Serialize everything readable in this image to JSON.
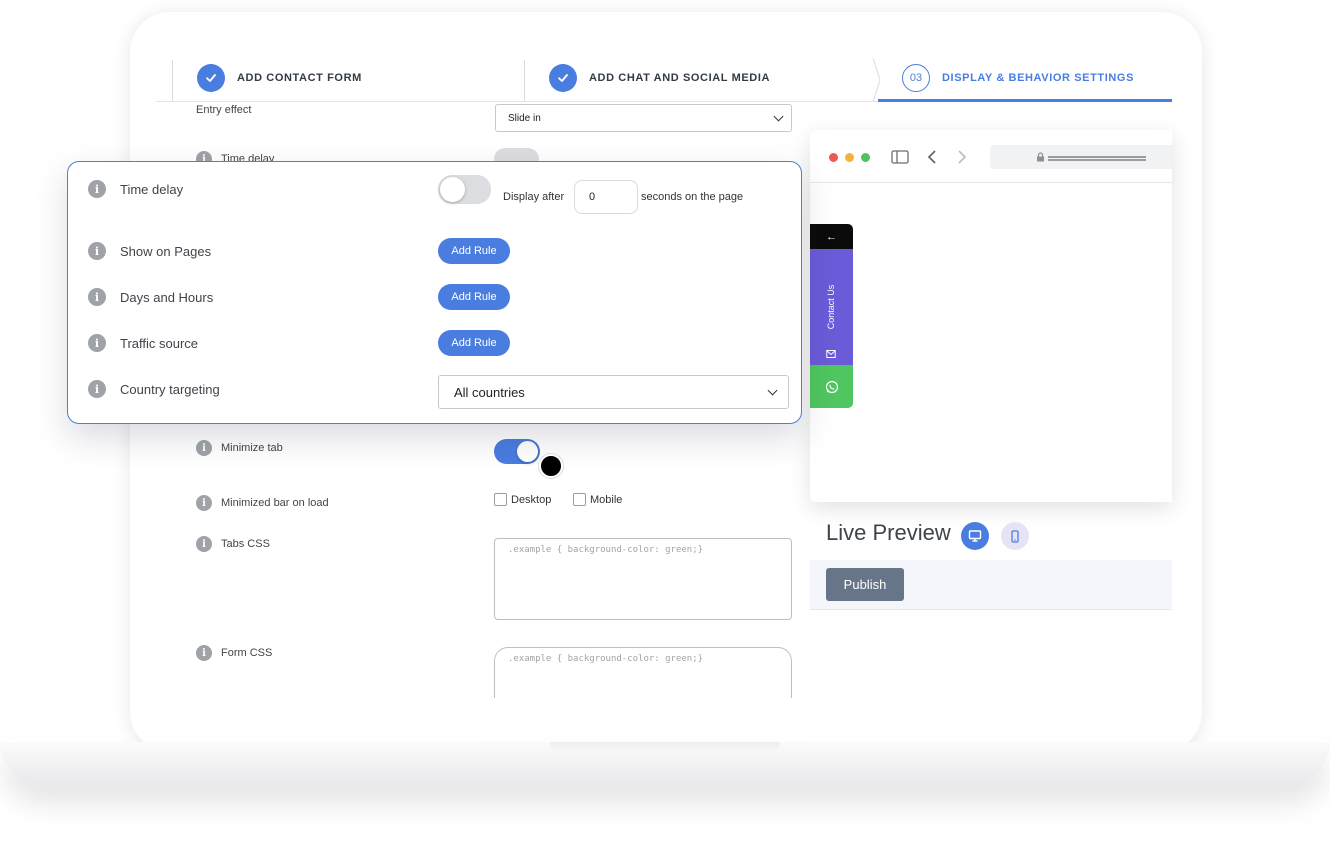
{
  "steps": [
    {
      "label": "ADD CONTACT FORM",
      "state": "done"
    },
    {
      "label": "ADD CHAT AND SOCIAL MEDIA",
      "state": "done"
    },
    {
      "label": "DISPLAY & BEHAVIOR SETTINGS",
      "number": "03",
      "state": "active"
    }
  ],
  "colors": {
    "accent": "#4a7de0",
    "contact_tab": "#6a5bd8",
    "whatsapp": "#4fc65f",
    "publish": "#677589"
  },
  "form": {
    "entry_effect": {
      "label": "Entry effect",
      "value": "Slide in"
    },
    "time_delay_label": "Time delay",
    "minimize_tab": {
      "label": "Minimize tab",
      "enabled": true
    },
    "minimized_bar": {
      "label": "Minimized bar on load",
      "desktop": "Desktop",
      "mobile": "Mobile"
    },
    "tabs_css": {
      "label": "Tabs CSS",
      "placeholder": ".example { background-color: green;}"
    },
    "form_css": {
      "label": "Form CSS",
      "placeholder": ".example { background-color: green;}"
    }
  },
  "card": {
    "time_delay": {
      "label": "Time delay",
      "enabled": false,
      "prefix": "Display after",
      "value": "0",
      "suffix": "seconds on the page"
    },
    "show_on_pages": {
      "label": "Show on Pages",
      "button": "Add Rule"
    },
    "days_hours": {
      "label": "Days and Hours",
      "button": "Add Rule"
    },
    "traffic_source": {
      "label": "Traffic source",
      "button": "Add Rule"
    },
    "country": {
      "label": "Country targeting",
      "value": "All countries"
    }
  },
  "preview": {
    "widget_arrow": "←",
    "contact_label": "Contact Us",
    "live_preview_title": "Live Preview",
    "publish_label": "Publish"
  }
}
